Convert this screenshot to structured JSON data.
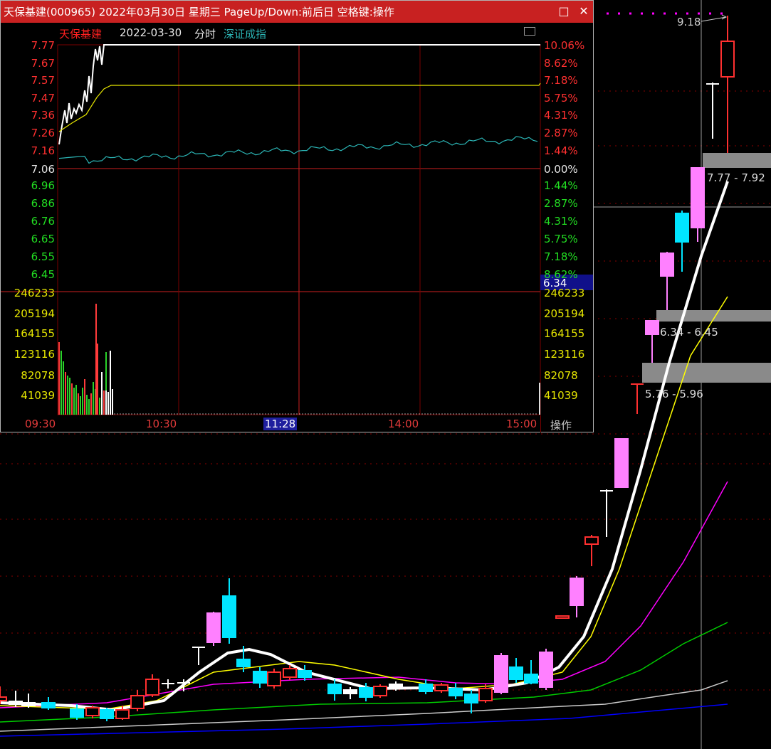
{
  "window": {
    "title": "天保基建(000965) 2022年03月30日 星期三 PageUp/Down:前后日 空格键:操作",
    "maximize_glyph": "□",
    "close_glyph": "✕"
  },
  "header": {
    "stock_name": "天保基建",
    "date": "2022-03-30",
    "mode": "分时",
    "index_name": "深证成指"
  },
  "intraday": {
    "price_labels": [
      "7.77",
      "7.67",
      "7.57",
      "7.47",
      "7.36",
      "7.26",
      "7.16",
      "7.06",
      "6.96",
      "6.86",
      "6.76",
      "6.65",
      "6.55",
      "6.45"
    ],
    "pct_labels": [
      "10.06%",
      "8.62%",
      "7.18%",
      "5.75%",
      "4.31%",
      "2.87%",
      "1.44%",
      "0.00%",
      "1.44%",
      "2.87%",
      "4.31%",
      "5.75%",
      "7.18%",
      "8.62%"
    ],
    "volume_labels": [
      "246233",
      "205194",
      "164155",
      "123116",
      "82078",
      "41039"
    ],
    "cursor_price": "6.34",
    "time_labels": [
      "09:30",
      "10:30",
      "11:28",
      "14:00",
      "15:00"
    ],
    "ops_label": "操作",
    "colors": {
      "up": "#ff3b3b",
      "down": "#2ad12a",
      "flat": "#ffffff",
      "avg": "#e6e600",
      "index": "#2bb5b5",
      "grid": "#7a0000"
    }
  },
  "kline": {
    "high_label": "9.18",
    "zones": [
      {
        "label": "7.77 - 7.92"
      },
      {
        "label": "6.34 - 6.45"
      },
      {
        "label": "5.76 - 5.96"
      }
    ],
    "colors": {
      "up": "#ff3030",
      "down": "#00e5ff",
      "strong_up": "#ff80ff",
      "ma5": "#ffffff",
      "ma10": "#ffff00",
      "ma20": "#ff00ff",
      "ma30": "#00cc00",
      "ma60": "#cccccc",
      "ma120": "#0000ff"
    }
  }
}
